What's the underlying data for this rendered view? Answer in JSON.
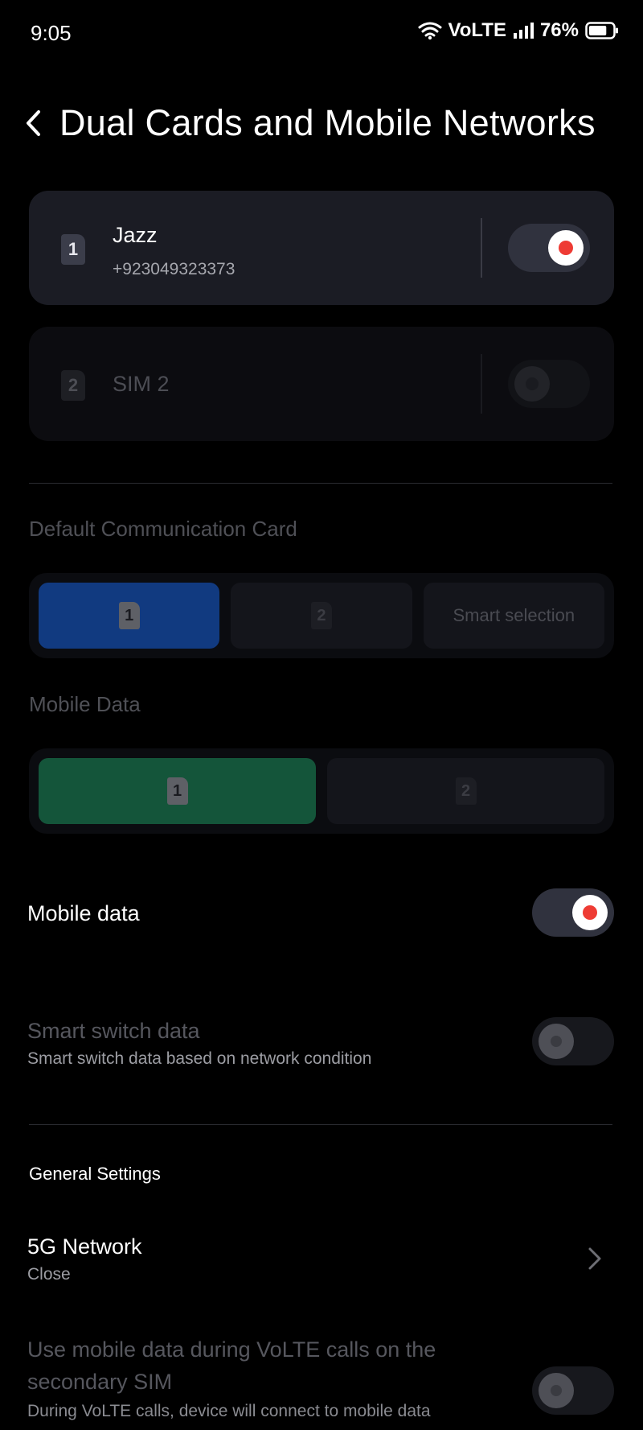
{
  "status_bar": {
    "time": "9:05",
    "network_label": "VoLTE",
    "battery_text": "76%",
    "battery_level": 0.76
  },
  "header": {
    "title": "Dual Cards and Mobile Networks"
  },
  "sims": [
    {
      "slot": "1",
      "name": "Jazz",
      "number": "+923049323373",
      "enabled": true
    },
    {
      "slot": "2",
      "name": "SIM 2",
      "enabled": false
    }
  ],
  "default_comm": {
    "label": "Default Communication Card",
    "options": [
      {
        "sim": "1",
        "selected": true
      },
      {
        "sim": "2",
        "selected": false
      },
      {
        "label": "Smart selection",
        "selected": false
      }
    ]
  },
  "mobile_data_card": {
    "label": "Mobile Data",
    "options": [
      {
        "sim": "1",
        "selected": true
      },
      {
        "sim": "2",
        "selected": false
      }
    ]
  },
  "mobile_data": {
    "title": "Mobile data",
    "enabled": true
  },
  "smart_switch": {
    "title": "Smart switch data",
    "subtitle": "Smart switch data based on network condition",
    "enabled": false
  },
  "general_settings": {
    "label": "General Settings"
  },
  "network_5g": {
    "title": "5G Network",
    "value": "Close"
  },
  "volte_secondary": {
    "title_line1": "Use mobile data during VoLTE calls on the",
    "title_line2": "secondary SIM",
    "subtitle": "During VoLTE calls, device will connect to mobile data",
    "enabled": false
  },
  "colors": {
    "accent_red": "#ee3b34",
    "selected_blue": "#113a80",
    "selected_green": "#14553a"
  }
}
